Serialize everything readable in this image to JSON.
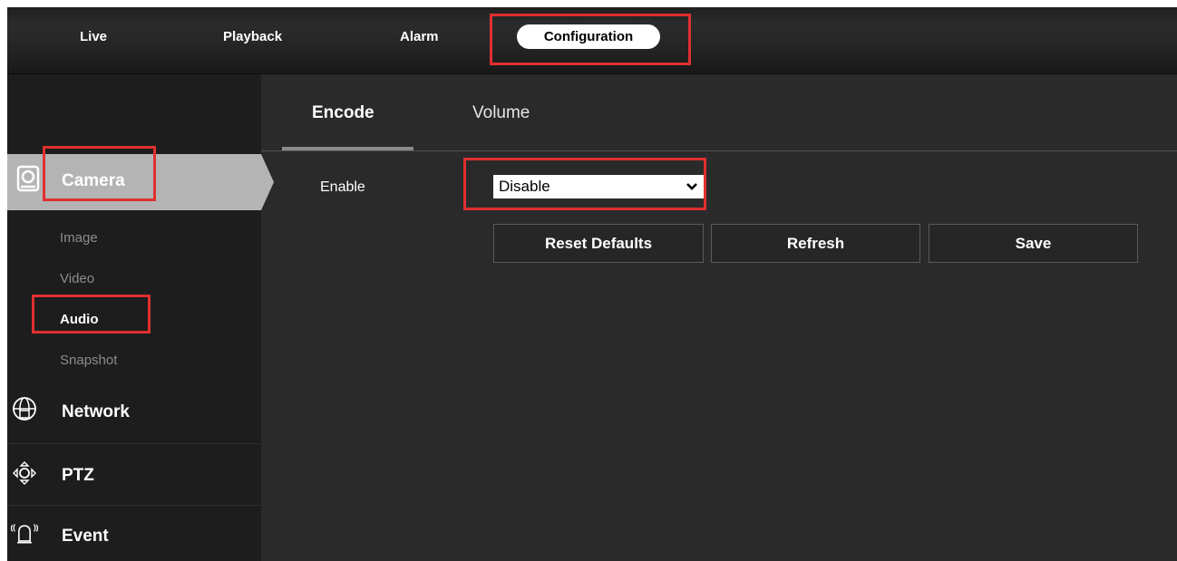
{
  "top_nav": {
    "items": [
      "Live",
      "Playback",
      "Alarm"
    ],
    "active": "Configuration"
  },
  "sidebar": {
    "camera_label": "Camera",
    "camera_icon": "camera-icon",
    "sub_items": [
      "Image",
      "Video",
      "Audio",
      "Snapshot"
    ],
    "active_sub_item": "Audio",
    "sections": [
      {
        "label": "Network",
        "icon": "network-globe-icon"
      },
      {
        "label": "PTZ",
        "icon": "ptz-arrows-icon"
      },
      {
        "label": "Event",
        "icon": "alarm-bell-icon"
      }
    ]
  },
  "tabs": {
    "items": [
      "Encode",
      "Volume"
    ],
    "active": "Encode"
  },
  "form": {
    "enable_label": "Enable",
    "enable_value": "Disable"
  },
  "buttons": {
    "reset": "Reset Defaults",
    "refresh": "Refresh",
    "save": "Save"
  },
  "colors": {
    "highlight": "#e03030",
    "background": "#2a2a2a",
    "sidebar": "#1d1d1d",
    "active_item": "#b4b4b4"
  }
}
